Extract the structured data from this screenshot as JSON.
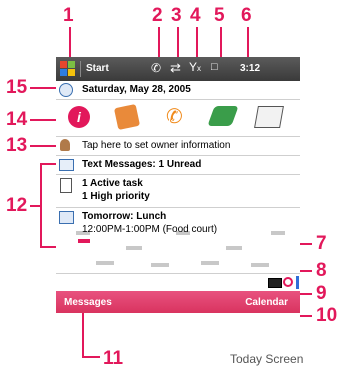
{
  "title_bar": {
    "start_label": "Start",
    "time": "3:12"
  },
  "today": {
    "date": "Saturday, May 28, 2005",
    "owner_prompt": "Tap here to set owner information",
    "messages": "Text Messages: 1 Unread",
    "tasks_line1": "1 Active task",
    "tasks_line2": "1 High priority",
    "calendar_title": "Tomorrow: Lunch",
    "calendar_detail": "12:00PM-1:00PM (Food court)"
  },
  "softkeys": {
    "left": "Messages",
    "right": "Calendar"
  },
  "callouts": {
    "c1": "1",
    "c2": "2",
    "c3": "3",
    "c4": "4",
    "c5": "5",
    "c6": "6",
    "c7": "7",
    "c8": "8",
    "c9": "9",
    "c10": "10",
    "c11": "11",
    "c12": "12",
    "c13": "13",
    "c14": "14",
    "c15": "15"
  },
  "caption": "Today Screen",
  "colors": {
    "accent": "#e2185b",
    "titlebar": "#4a4a4a",
    "softkey": "#dd3b66"
  }
}
